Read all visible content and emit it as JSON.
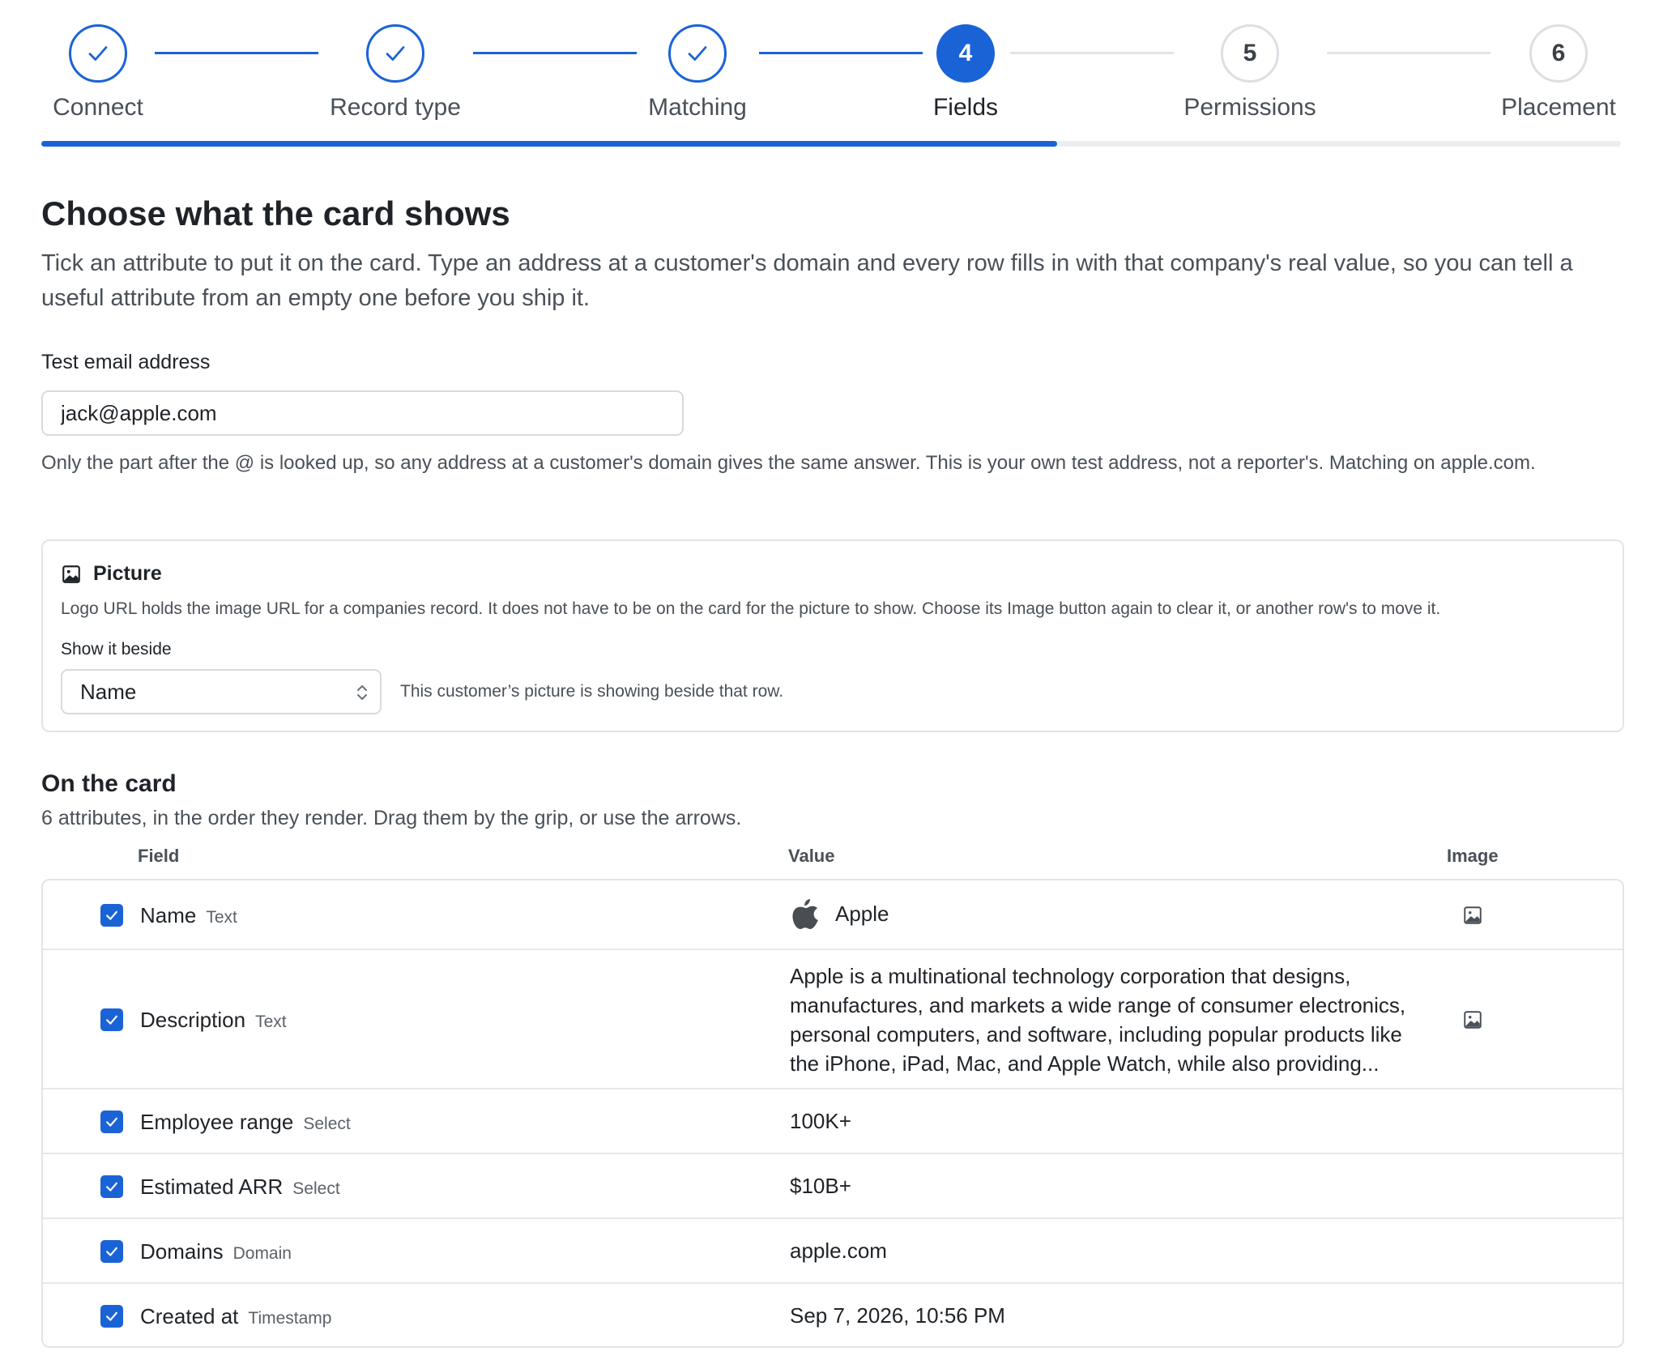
{
  "stepper": {
    "steps": [
      {
        "number": "1",
        "label": "Connect",
        "state": "done"
      },
      {
        "number": "2",
        "label": "Record type",
        "state": "done"
      },
      {
        "number": "3",
        "label": "Matching",
        "state": "done"
      },
      {
        "number": "4",
        "label": "Fields",
        "state": "current"
      },
      {
        "number": "5",
        "label": "Permissions",
        "state": "future"
      },
      {
        "number": "6",
        "label": "Placement",
        "state": "future"
      }
    ],
    "progress_fraction": 0.643
  },
  "header": {
    "title": "Choose what the card shows",
    "description": "Tick an attribute to put it on the card. Type an address at a customer's domain and every row fills in with that company's real value, so you can tell a useful attribute from an empty one before you ship it."
  },
  "email": {
    "label": "Test email address",
    "value": "jack@apple.com",
    "help": "Only the part after the @ is looked up, so any address at a customer's domain gives the same answer. This is your own test address, not a reporter's. Matching on apple.com."
  },
  "picture": {
    "title": "Picture",
    "description": "Logo URL holds the image URL for a companies record. It does not have to be on the card for the picture to show. Choose its Image button again to clear it, or another row's to move it.",
    "select_label": "Show it beside",
    "selected": "Name",
    "status": "This customer’s picture is showing beside that row."
  },
  "on_card": {
    "title": "On the card",
    "description": "6 attributes, in the order they render. Drag them by the grip, or use the arrows.",
    "columns": {
      "field": "Field",
      "value": "Value",
      "image": "Image"
    },
    "rows": [
      {
        "name": "Name",
        "type": "Text",
        "value": "Apple",
        "checked": true
      },
      {
        "name": "Description",
        "type": "Text",
        "value": "Apple is a multinational technology corporation that designs, manufactures, and markets a wide range of consumer electronics, personal computers, and software, including popular products like the iPhone, iPad, Mac, and Apple Watch, while also providing...",
        "checked": true
      },
      {
        "name": "Employee range",
        "type": "Select",
        "value": "100K+",
        "checked": true
      },
      {
        "name": "Estimated ARR",
        "type": "Select",
        "value": "$10B+",
        "checked": true
      },
      {
        "name": "Domains",
        "type": "Domain",
        "value": "apple.com",
        "checked": true
      },
      {
        "name": "Created at",
        "type": "Timestamp",
        "value": "Sep 7, 2026, 10:56 PM",
        "checked": true
      }
    ]
  },
  "colors": {
    "accent": "#1a63d6",
    "muted": "#4a5057",
    "border": "#e1e4e8"
  },
  "icons": {
    "done": "check-icon",
    "picture": "image-icon",
    "logo": "apple-logo-icon",
    "select": "chevron-updown-icon"
  }
}
